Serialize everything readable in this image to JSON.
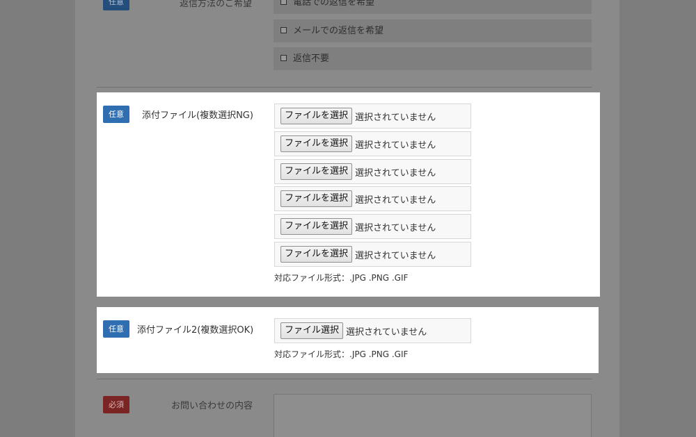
{
  "reply_method": {
    "badge": "任意",
    "label": "返信方法のご希望",
    "options": [
      "電話での返信を希望",
      "メールでの返信を希望",
      "返信不要"
    ]
  },
  "attachment_ng": {
    "badge": "任意",
    "label": "添付ファイル(複数選択NG)",
    "button_label": "ファイルを選択",
    "status": "選択されていません",
    "row_count": 6,
    "note": "対応ファイル形式：.JPG .PNG .GIF"
  },
  "attachment_ok": {
    "badge": "任意",
    "label": "添付ファイル2(複数選択OK)",
    "button_label": "ファイル選択",
    "status": "選択されていません",
    "note": "対応ファイル形式：.JPG .PNG .GIF"
  },
  "inquiry": {
    "badge": "必須",
    "label": "お問い合わせの内容"
  }
}
